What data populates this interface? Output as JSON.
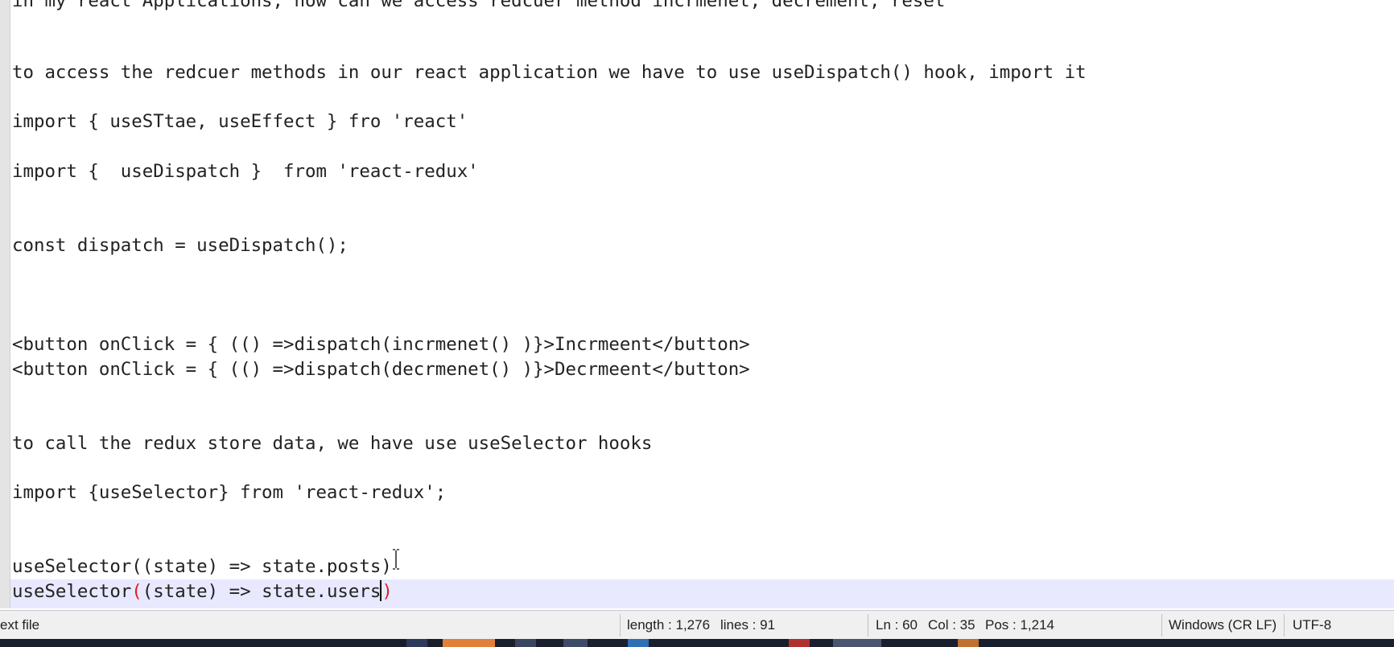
{
  "editor": {
    "lines": [
      "in my react Applications, how can we access redcuer method incrmenet, decrement, reset",
      "to access the redcuer methods in our react application we have to use useDispatch() hook, import it",
      "import { useSTtae, useEffect } fro 'react'",
      "import {  useDispatch }  from 'react-redux'",
      "const dispatch = useDispatch();",
      "<button onClick = { (() =>dispatch(incrmenet() )}>Incrmeent</button>",
      "<button onClick = { (() =>dispatch(decrmenet() )}>Decrmeent</button>",
      "to call the redux store data, we have use useSelector hooks",
      "import {useSelector} from 'react-redux';",
      "useSelector((state) => state.posts)",
      "useSelector",
      "(",
      "(state) => state.users",
      ")"
    ]
  },
  "status": {
    "mode": "ext file",
    "length": "length : 1,276",
    "lines": "lines : 91",
    "ln": "Ln : 60",
    "col": "Col : 35",
    "pos": "Pos : 1,214",
    "eol": "Windows (CR LF)",
    "encoding": "UTF-8"
  },
  "colors": {
    "current_line": "#e8e8ff",
    "brace_match": "#e02020",
    "taskbar": "#1a1f2e",
    "taskbar_active": "#e0803a"
  }
}
